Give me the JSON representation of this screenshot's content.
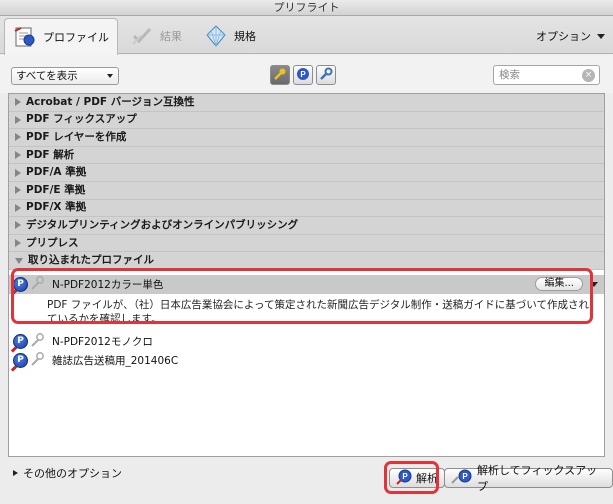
{
  "window": {
    "title": "プリフライト"
  },
  "tabs": [
    {
      "label": "プロファイル",
      "icon": "profile-icon",
      "state": "active"
    },
    {
      "label": "結果",
      "icon": "checkmark-icon",
      "state": "disabled"
    },
    {
      "label": "規格",
      "icon": "diamond-icon",
      "state": "normal"
    }
  ],
  "options_menu": {
    "label": "オプション"
  },
  "filter": {
    "selected": "すべてを表示",
    "search_placeholder": "検索"
  },
  "categories": [
    {
      "label": "Acrobat / PDF バージョン互換性"
    },
    {
      "label": "PDF フィックスアップ"
    },
    {
      "label": "PDF レイヤーを作成"
    },
    {
      "label": "PDF 解析"
    },
    {
      "label": "PDF/A 準拠"
    },
    {
      "label": "PDF/E 準拠"
    },
    {
      "label": "PDF/X 準拠"
    },
    {
      "label": "デジタルプリンティングおよびオンラインパブリッシング"
    },
    {
      "label": "プリプレス"
    }
  ],
  "imported": {
    "label": "取り込まれたプロファイル",
    "profiles": [
      {
        "name": "N-PDF2012カラー単色",
        "edit_label": "編集...",
        "description": "PDF ファイルが、（社）日本広告業協会によって策定された新聞広告デジタル制作・送稿ガイドに基づいて作成されているかを確認します。"
      },
      {
        "name": "N-PDF2012モノクロ"
      },
      {
        "name": "雑誌広告送稿用_201406C"
      }
    ]
  },
  "footer": {
    "more_options": "その他のオプション",
    "analyze": "解析",
    "analyze_fix": "解析してフィックスアップ"
  },
  "colors": {
    "highlight": "#e0343a",
    "badge": "#1940a3"
  }
}
